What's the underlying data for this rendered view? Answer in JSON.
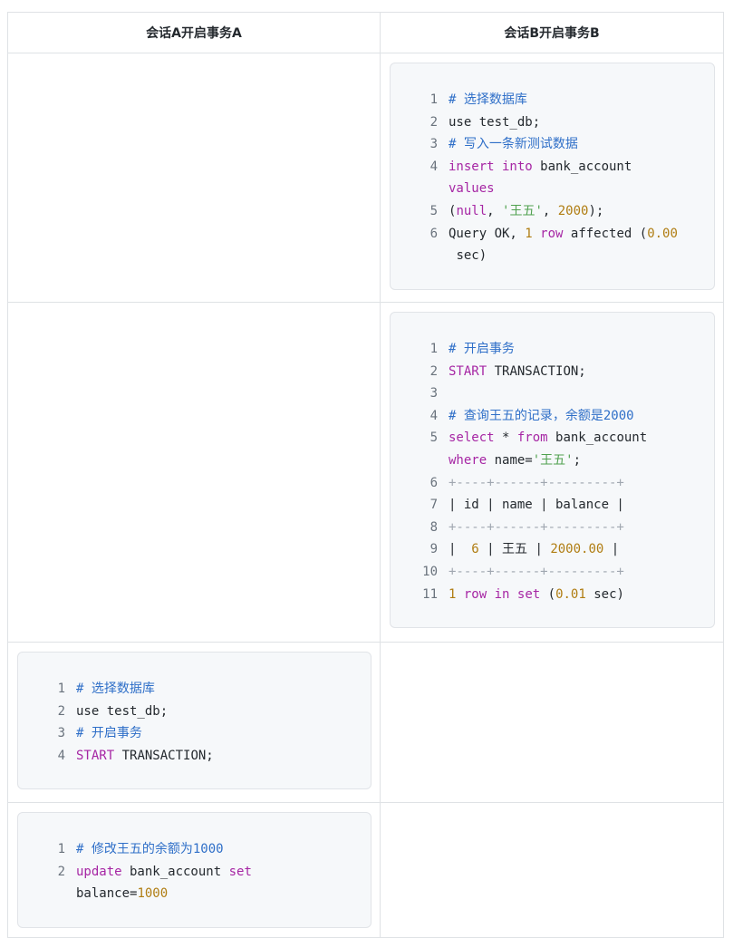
{
  "table": {
    "headers": [
      "会话A开启事务A",
      "会话B开启事务B"
    ]
  },
  "rows": [
    {
      "a": null,
      "b": [
        "# 选择数据库",
        "use test_db;",
        "# 写入一条新测试数据",
        "insert into bank_account values (null, '王五', 2000);",
        "Query OK, 1 row affected (0.00 sec)"
      ]
    },
    {
      "a": null,
      "b": [
        "# 开启事务",
        "START TRANSACTION;",
        "",
        "# 查询王五的记录，余额是2000",
        "select * from bank_account where name='王五';",
        "+----+------+---------+",
        "| id | name | balance |",
        "+----+------+---------+",
        "|  6 | 王五 | 2000.00 |",
        "+----+------+---------+",
        "1 row in set (0.01 sec)"
      ]
    },
    {
      "a": [
        "# 选择数据库",
        "use test_db;",
        "# 开启事务",
        "START TRANSACTION;"
      ],
      "b": null
    },
    {
      "a": [
        "# 修改王五的余额为1000",
        "update bank_account set balance=1000"
      ],
      "b": null
    }
  ],
  "line_numbers": {
    "r1b": [
      "1",
      "2",
      "3",
      "4",
      "5",
      "6"
    ],
    "r2b": [
      "1",
      "2",
      "3",
      "4",
      "5",
      "6",
      "7",
      "8",
      "9",
      "10",
      "11"
    ],
    "r3a": [
      "1",
      "2",
      "3",
      "4"
    ],
    "r4a": [
      "1",
      "2"
    ]
  }
}
